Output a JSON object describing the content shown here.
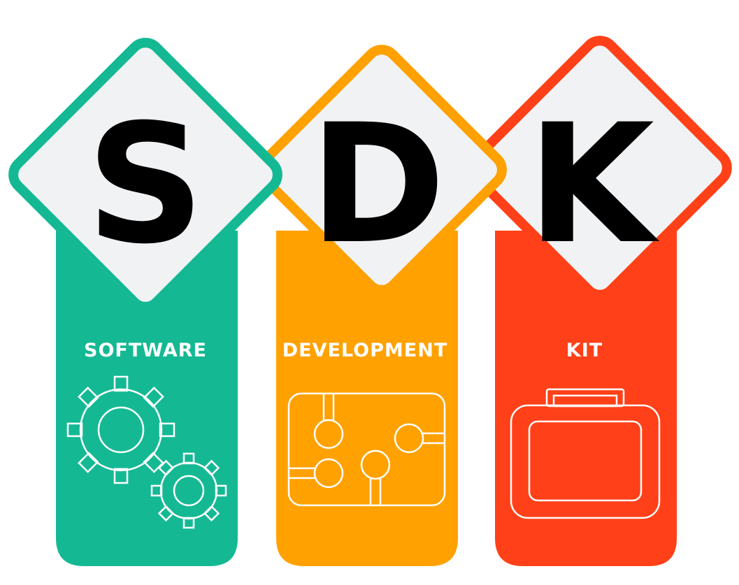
{
  "title_letters": [
    "S",
    "D",
    "K"
  ],
  "columns": [
    {
      "letter": "S",
      "label": "SOFTWARE",
      "color": "#14b994",
      "icon": "gears-icon"
    },
    {
      "letter": "D",
      "label": "DEVELOPMENT",
      "color": "#ffa101",
      "icon": "circuit-board-icon"
    },
    {
      "letter": "K",
      "label": "KIT",
      "color": "#ff4018",
      "icon": "briefcase-icon"
    }
  ],
  "diamond_fill": "#f1f2f4"
}
